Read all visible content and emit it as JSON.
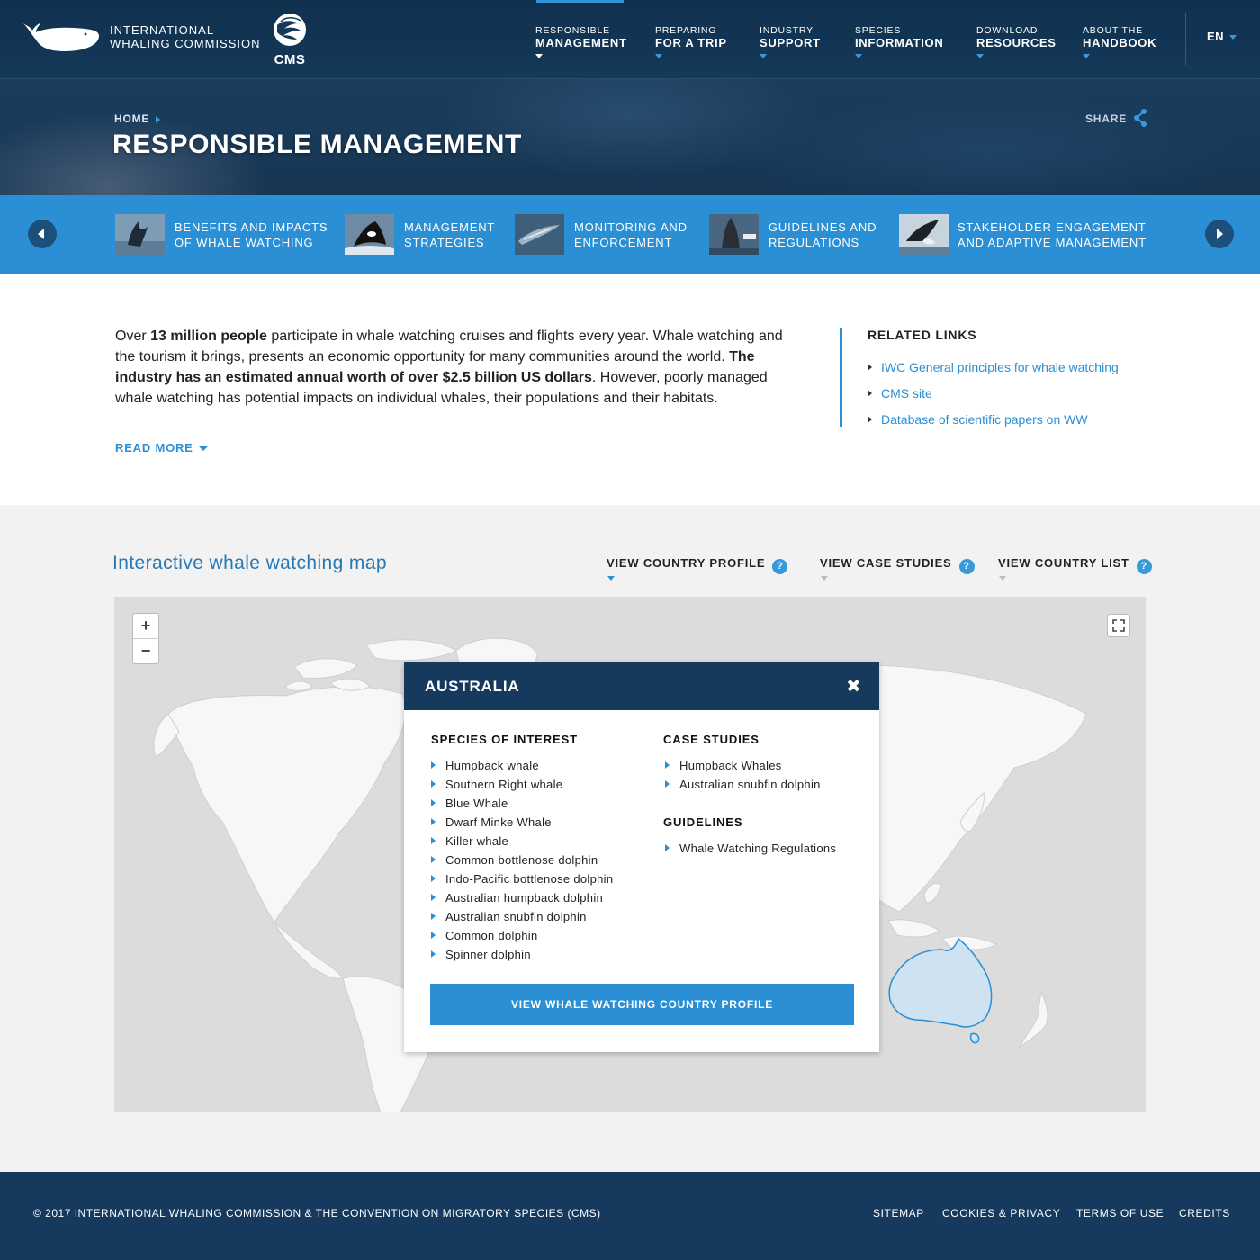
{
  "header": {
    "logo_line1": "INTERNATIONAL",
    "logo_line2": "WHALING COMMISSION",
    "cms_label": "CMS",
    "nav": [
      {
        "line1": "RESPONSIBLE",
        "line2": "MANAGEMENT"
      },
      {
        "line1": "PREPARING",
        "line2": "FOR A TRIP"
      },
      {
        "line1": "INDUSTRY",
        "line2": "SUPPORT"
      },
      {
        "line1": "SPECIES",
        "line2": "INFORMATION"
      },
      {
        "line1": "DOWNLOAD",
        "line2": "RESOURCES"
      },
      {
        "line1": "ABOUT THE",
        "line2": "HANDBOOK"
      }
    ],
    "active_nav_index": 0,
    "language": "EN"
  },
  "hero": {
    "breadcrumb_home": "HOME",
    "title": "RESPONSIBLE MANAGEMENT",
    "share_label": "SHARE"
  },
  "subnav": {
    "items": [
      {
        "line1": "BENEFITS AND IMPACTS",
        "line2": "OF WHALE WATCHING"
      },
      {
        "line1": "MANAGEMENT",
        "line2": "STRATEGIES"
      },
      {
        "line1": "MONITORING AND",
        "line2": "ENFORCEMENT"
      },
      {
        "line1": "GUIDELINES AND",
        "line2": "REGULATIONS"
      },
      {
        "line1": "STAKEHOLDER ENGAGEMENT",
        "line2": "AND ADAPTIVE MANAGEMENT"
      }
    ]
  },
  "intro": {
    "p1_a": "Over ",
    "p1_b": "13 million people",
    "p1_c": " participate in whale watching cruises and flights every year. Whale watching and the tourism it brings, presents an economic opportunity for many communities around the world. ",
    "p1_d": "The industry has an estimated annual worth of over $2.5 billion US dollars",
    "p1_e": ". However, poorly managed whale watching has potential impacts on individual whales, their populations and their habitats.",
    "read_more": "READ MORE"
  },
  "related": {
    "title": "RELATED LINKS",
    "links": [
      "IWC General principles for whale watching",
      "CMS site",
      "Database of scientific papers on WW"
    ]
  },
  "map": {
    "title": "Interactive whale watching map",
    "tabs": [
      "VIEW COUNTRY PROFILE",
      "VIEW CASE STUDIES",
      "VIEW COUNTRY LIST"
    ],
    "active_tab_index": 0,
    "help_glyph": "?",
    "zoom_in": "+",
    "zoom_out": "−",
    "popup": {
      "country": "AUSTRALIA",
      "close": "✖",
      "species_title": "SPECIES OF INTEREST",
      "species": [
        "Humpback whale",
        "Southern Right whale",
        "Blue Whale",
        "Dwarf Minke Whale",
        "Killer whale",
        "Common bottlenose dolphin",
        "Indo-Pacific bottlenose dolphin",
        "Australian humpback dolphin",
        "Australian snubfin dolphin",
        "Common dolphin",
        "Spinner dolphin"
      ],
      "case_title": "CASE STUDIES",
      "cases": [
        "Humpback Whales",
        "Australian snubfin dolphin"
      ],
      "guidelines_title": "GUIDELINES",
      "guidelines": [
        "Whale Watching Regulations"
      ],
      "button": "VIEW WHALE WATCHING COUNTRY PROFILE"
    }
  },
  "footer": {
    "copyright": "© 2017 INTERNATIONAL WHALING COMMISSION & THE CONVENTION ON MIGRATORY SPECIES (CMS)",
    "links": [
      "SITEMAP",
      "COOKIES & PRIVACY",
      "TERMS OF USE",
      "CREDITS"
    ]
  },
  "colors": {
    "navy": "#153a5e",
    "accent_blue": "#2a8fd4",
    "link_blue": "#2878b4",
    "australia_fill": "#cfe2f1"
  }
}
